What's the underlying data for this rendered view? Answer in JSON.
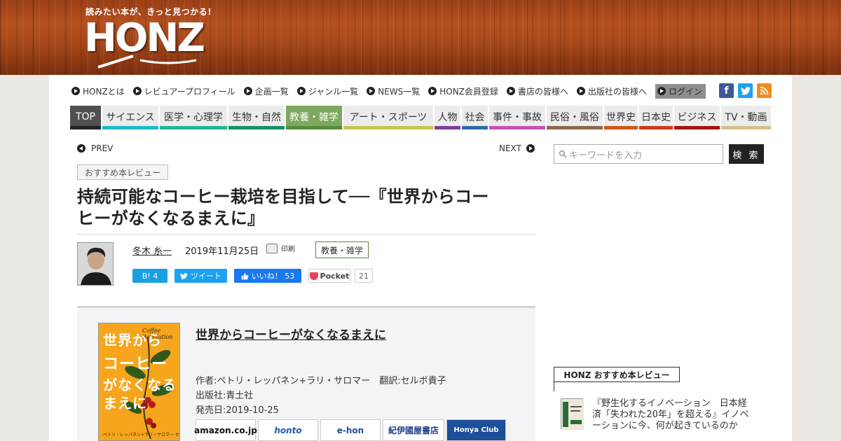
{
  "header": {
    "tagline": "読みたい本が、きっと見つかる!",
    "logo": "HONZ"
  },
  "topnav": [
    "HONZとは",
    "レビュアープロフィール",
    "企画一覧",
    "ジャンル一覧",
    "NEWS一覧",
    "HONZ会員登録",
    "書店の皆様へ",
    "出版社の皆様へ",
    "ログイン"
  ],
  "social_icons": [
    "facebook-icon",
    "twitter-icon",
    "rss-icon"
  ],
  "categories": [
    {
      "label": "TOP",
      "color": "#222222"
    },
    {
      "label": "サイエンス",
      "color": "#1fb8c9"
    },
    {
      "label": "医学・心理学",
      "color": "#20b89a"
    },
    {
      "label": "生物・自然",
      "color": "#14906a"
    },
    {
      "label": "教養・雑学",
      "color": "#5a8a3c"
    },
    {
      "label": "アート・スポーツ",
      "color": "#c9c44a"
    },
    {
      "label": "人物",
      "color": "#7e3f97"
    },
    {
      "label": "社会",
      "color": "#2f6aa8"
    },
    {
      "label": "事件・事故",
      "color": "#c84fb7"
    },
    {
      "label": "民俗・風俗",
      "color": "#8b6a4a"
    },
    {
      "label": "世界史",
      "color": "#d0571a"
    },
    {
      "label": "日本史",
      "color": "#cc3a1e"
    },
    {
      "label": "ビジネス",
      "color": "#a01515"
    },
    {
      "label": "TV・動画",
      "color": "#d9c08a"
    }
  ],
  "pager": {
    "prev": "PREV",
    "next": "NEXT"
  },
  "article": {
    "tag": "おすすめ本レビュー",
    "title_line1": "持続可能なコーヒー栽培を目指して──『世界からコー",
    "title_line2": "ヒーがなくなるまえに』",
    "author": "冬木 糸一",
    "date": "2019年11月25日",
    "print": "印刷",
    "category": "教養・雑学"
  },
  "share": {
    "hatena": "B! 4",
    "tweet": "ツイート",
    "like": "いいね！ 53",
    "pocket": "Pocket",
    "pocket_count": "21"
  },
  "book": {
    "cover_lines": [
      "世界から",
      "コーヒー",
      "がなくなる",
      "まえに"
    ],
    "cover_script": "Coffee Revolution",
    "cover_author": "ペトリ・レッパネン+ラリ・サロマー  セルボ貴子訳",
    "title": "世界からコーヒーがなくなるまえに",
    "authors": "作者:ペトリ・レッパネン+ラリ・サロマー　翻訳:セルボ貴子",
    "publisher": "出版社:青土社",
    "release": "発売日:2019-10-25",
    "shops": [
      "amazon.co.jp",
      "honto",
      "e-hon",
      "紀伊國屋書店",
      "Honya Club"
    ]
  },
  "sidebar": {
    "search_placeholder": "キーワードを入力",
    "search_button": "検 索",
    "rec_heading": "HONZ おすすめ本レビュー",
    "rec_item": "『野生化するイノベーション　日本経済「失われた20年」を超える』イノベーションに今、何が起きているのか"
  }
}
